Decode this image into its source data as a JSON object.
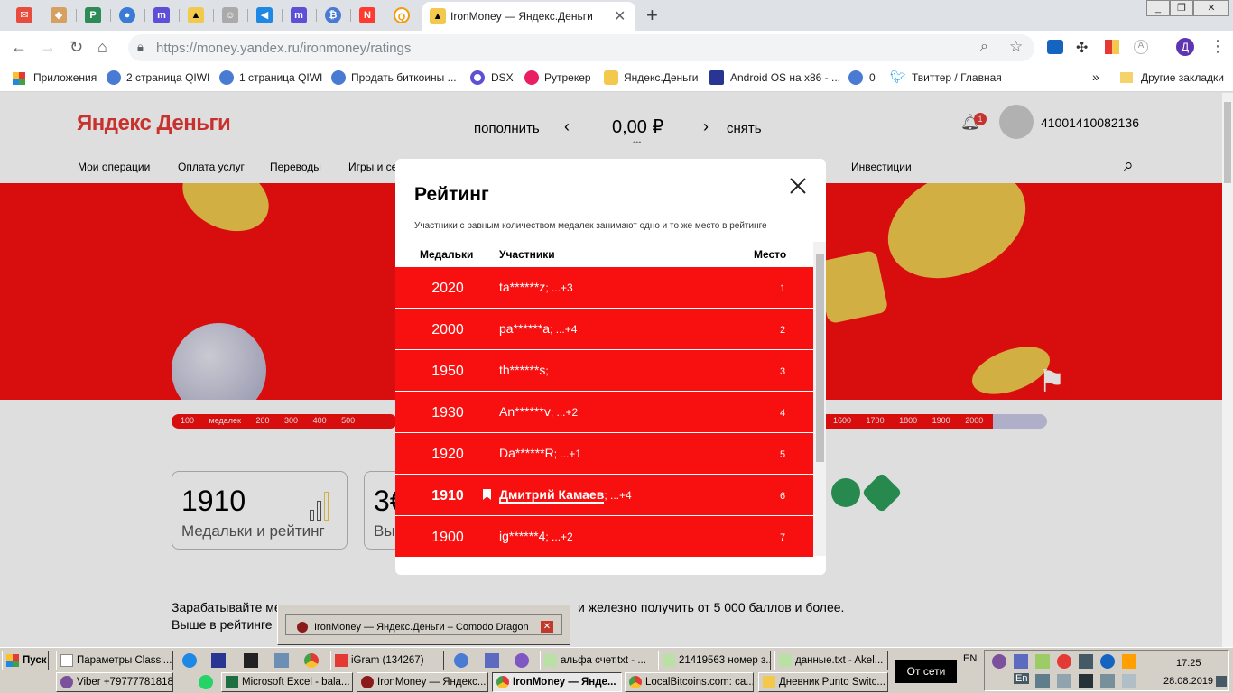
{
  "browser": {
    "active_tab_title": "IronMoney — Яндекс.Деньги",
    "url_host": "https://money.yandex.ru",
    "url_path": "/ironmoney/ratings",
    "profile_initial": "Д",
    "other_bookmarks": "Другие закладки"
  },
  "bookmarks": [
    "Приложения",
    "2 страница QIWI",
    "1 страница QIWI",
    "Продать биткоины ...",
    "DSX",
    "Рутрекер",
    "Яндекс.Деньги",
    "Android OS на x86 - ...",
    "0",
    "Твиттер / Главная"
  ],
  "site": {
    "logo": "Яндекс Деньги",
    "topup": "пополнить",
    "balance": "0,00 ₽",
    "withdraw": "снять",
    "notif_count": "1",
    "account": "41001410082136",
    "nav": [
      "Мои операции",
      "Оплата услуг",
      "Переводы",
      "Игры и се",
      "Инвестиции"
    ],
    "scale_left": [
      "100 медалек",
      "200",
      "300",
      "400",
      "500"
    ],
    "scale_right": [
      "1600",
      "1700",
      "1800",
      "1900",
      "2000"
    ],
    "card1_value": "1910",
    "card1_label": "Медальки и рейтинг",
    "card2_value": "3€",
    "card2_label": "Вы",
    "body_line1_start": "Зарабатывайте ме",
    "body_line1_end": "и железно получить от 5 000 баллов и более.",
    "body_line2": "Выше в рейтинге"
  },
  "modal": {
    "title": "Рейтинг",
    "subtitle": "Участники с равным количеством медалек занимают одно и то же место в рейтинге",
    "col_medals": "Медальки",
    "col_members": "Участники",
    "col_place": "Место",
    "rows": [
      {
        "medals": "2020",
        "name": "ta******z",
        "more": "; ...+3",
        "place": "1"
      },
      {
        "medals": "2000",
        "name": "pa******a",
        "more": "; ...+4",
        "place": "2"
      },
      {
        "medals": "1950",
        "name": "th******s",
        "more": ";",
        "place": "3"
      },
      {
        "medals": "1930",
        "name": "An******v",
        "more": "; ...+2",
        "place": "4"
      },
      {
        "medals": "1920",
        "name": "Da******R",
        "more": "; ...+1",
        "place": "5"
      },
      {
        "medals": "1910",
        "name": "Дмитрий Камаев",
        "more": "; ...+4",
        "place": "6"
      },
      {
        "medals": "1900",
        "name": "ig******4",
        "more": "; ...+2",
        "place": "7"
      }
    ]
  },
  "tooltip": "IronMoney — Яндекс.Деньги – Comodo Dragon",
  "taskbar": {
    "start": "Пуск",
    "row1": [
      "Параметры Classi...",
      "iGram (134267)",
      "альфа счет.txt - ...",
      "21419563 номер з...",
      "данные.txt - Akel..."
    ],
    "row2": [
      "Viber +79777781818",
      "Microsoft Excel - bala...",
      "IronMoney — Яндекс...",
      "IronMoney — Янде...",
      "LocalBitcoins.com: ca...",
      "Дневник Punto Switc..."
    ],
    "offline": "От сети",
    "lang": "EN",
    "lang2": "En",
    "time": "17:25",
    "date": "28.08.2019"
  },
  "colors": {
    "brand_red": "#f80f0f",
    "gold": "#f2c94c"
  }
}
